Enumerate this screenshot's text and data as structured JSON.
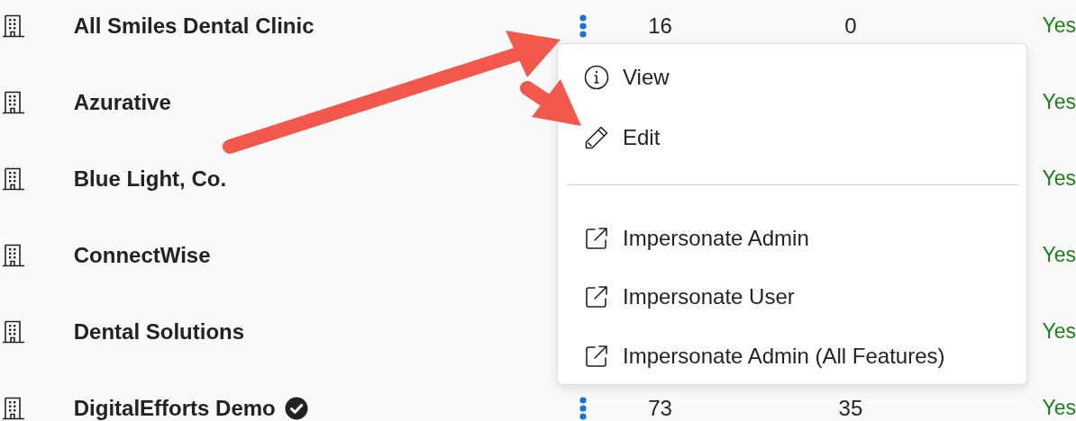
{
  "rows": [
    {
      "name": "All Smiles Dental Clinic",
      "counts": [
        "16",
        "0"
      ],
      "status": "Yes"
    },
    {
      "name": "Azurative",
      "status": "Yes"
    },
    {
      "name": "Blue Light, Co.",
      "status": "Yes"
    },
    {
      "name": "ConnectWise",
      "status": "Yes"
    },
    {
      "name": "Dental Solutions",
      "status": "Yes"
    },
    {
      "name": "DigitalEfforts Demo",
      "verified": true,
      "counts": [
        "73",
        "35"
      ],
      "status": "Yes"
    }
  ],
  "menu": {
    "items": [
      {
        "kind": "info",
        "label": "View"
      },
      {
        "kind": "edit",
        "label": "Edit"
      },
      {
        "kind": "divider"
      },
      {
        "kind": "external",
        "label": "Impersonate Admin"
      },
      {
        "kind": "external",
        "label": "Impersonate User"
      },
      {
        "kind": "external",
        "label": "Impersonate Admin (All Features)"
      }
    ]
  }
}
